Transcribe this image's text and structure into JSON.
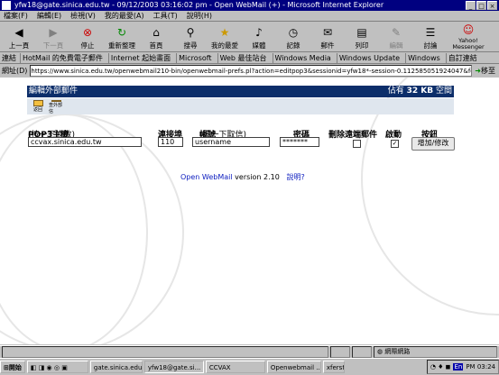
{
  "window": {
    "title": "yfw18@gate.sinica.edu.tw - 09/12/2003 03:16:02 pm - Open WebMail (+) - Microsoft Internet Explorer"
  },
  "menu": [
    "檔案(F)",
    "編輯(E)",
    "檢視(V)",
    "我的最愛(A)",
    "工具(T)",
    "說明(H)"
  ],
  "toolbar": [
    {
      "label": "上一頁",
      "icon": "back-icon",
      "enabled": true
    },
    {
      "label": "下一頁",
      "icon": "forward-icon",
      "enabled": false
    },
    {
      "label": "停止",
      "icon": "stop-icon",
      "enabled": true
    },
    {
      "label": "重新整理",
      "icon": "refresh-icon",
      "enabled": true
    },
    {
      "label": "首頁",
      "icon": "home-icon",
      "enabled": true
    },
    {
      "label": "搜尋",
      "icon": "search-icon",
      "enabled": true
    },
    {
      "label": "我的最愛",
      "icon": "favorites-icon",
      "enabled": true
    },
    {
      "label": "媒體",
      "icon": "media-icon",
      "enabled": true
    },
    {
      "label": "記錄",
      "icon": "history-icon",
      "enabled": true
    },
    {
      "label": "郵件",
      "icon": "mail-icon",
      "enabled": true
    },
    {
      "label": "列印",
      "icon": "print-icon",
      "enabled": true
    },
    {
      "label": "編輯",
      "icon": "edit-icon",
      "enabled": false
    },
    {
      "label": "討論",
      "icon": "discuss-icon",
      "enabled": true
    },
    {
      "label": "Yahoo! Messenger",
      "icon": "yahoo-messenger-icon",
      "enabled": true
    }
  ],
  "links": {
    "label": "連結",
    "items": [
      "HotMail 的免費電子郵件",
      "Internet 起始畫面",
      "Microsoft",
      "Web 最佳站台",
      "Windows Media",
      "Windows Update",
      "Windows",
      "自訂連結"
    ]
  },
  "address": {
    "label": "網址(D)",
    "url": "https://www.sinica.edu.tw/openwebmail210-bin/openwebmail-prefs.pl?action=editpop3&sessionid=yfw18*-session-0.112585051924047&folder=IN",
    "go": "移至"
  },
  "page": {
    "header_left": "編輯外部郵件",
    "header_right_prefix": "佔有",
    "header_right_size": "32 KB",
    "header_right_suffix": "空間",
    "icons": [
      "返回",
      "查外部信"
    ],
    "columns": {
      "host": "POP3主機",
      "host_hint": "(按一下修改)",
      "port": "連接埠",
      "account": "帳號",
      "account_hint": "(按一下取信)",
      "password": "密碼",
      "delete_remote": "刪除遠端郵件",
      "enable": "啟動",
      "action": "按鈕"
    },
    "row": {
      "host": "ccvax.sinica.edu.tw",
      "port": "110",
      "account": "username",
      "password": "*******",
      "delete_remote": "",
      "enable": "✓"
    },
    "add_button": "增加/修改",
    "footer_link": "Open WebMail",
    "footer_version": "version 2.10",
    "footer_help": "說明?"
  },
  "status": {
    "zone": "網際網路"
  },
  "taskbar": {
    "start": "開始",
    "tasks": [
      "gate.sinica.edu...",
      "yfw18@gate.si...",
      "CCVAX",
      "Openwebmail ...",
      "xferstat"
    ],
    "clock": "PM 03:24",
    "ime": "En"
  }
}
